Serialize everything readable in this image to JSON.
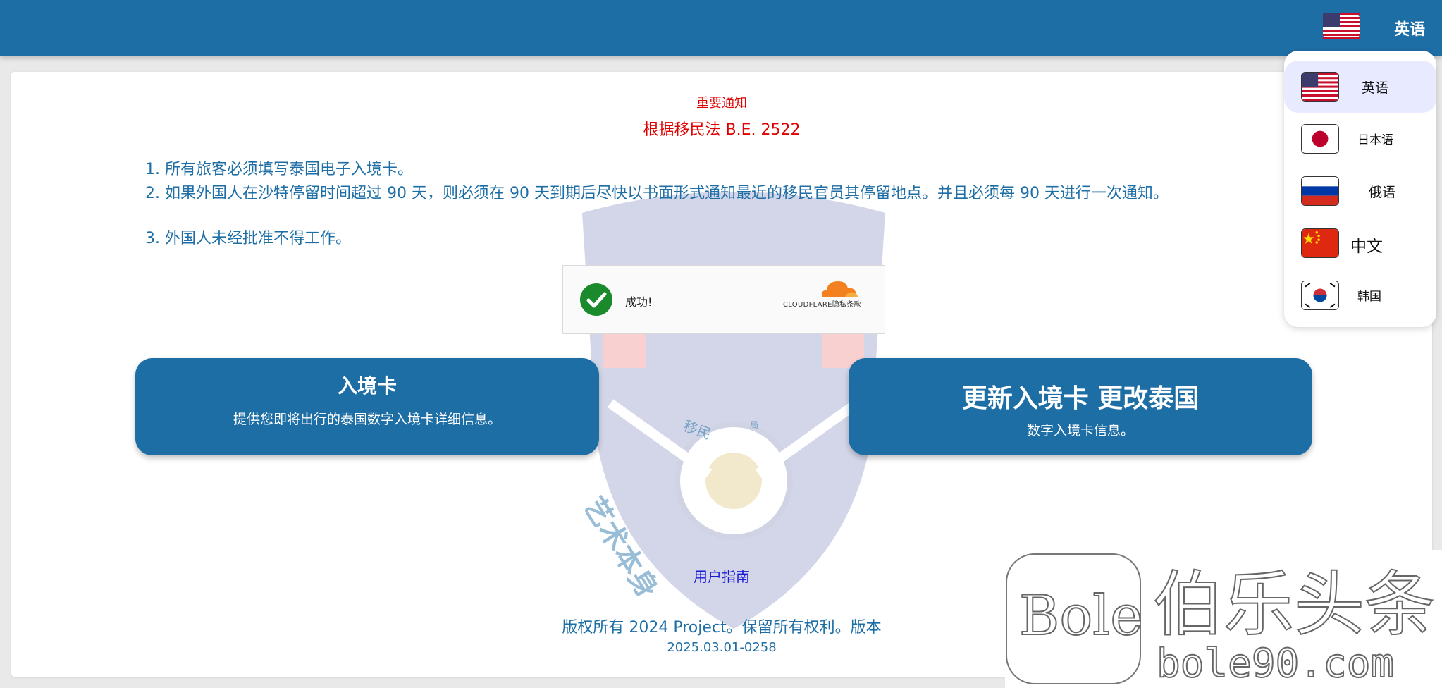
{
  "header": {
    "current_language": "英语",
    "flag_icon": "us-flag-icon"
  },
  "notice": {
    "title": "重要通知",
    "subtitle": "根据移民法 B.E. 2522"
  },
  "rules": [
    "1. 所有旅客必须填写泰国电子入境卡。",
    "2. 如果外国人在沙特停留时间超过 90 天，则必须在 90 天到期后尽快以书面形式通知最近的移民官员其停留地点。并且必须每 90 天进行一次通知。",
    "3. 外国人未经批准不得工作。"
  ],
  "captcha": {
    "status": "成功!",
    "brand": "CLOUDFLARE",
    "privacy": "隐私条款",
    "check_color": "#1a8a2c"
  },
  "actions": {
    "arrival_card": {
      "title": "入境卡",
      "desc": "提供您即将出行的泰国数字入境卡详细信息。"
    },
    "update_card": {
      "title": "更新入境卡 更改泰国",
      "desc": "数字入境卡信息。"
    }
  },
  "watermark_text": {
    "diagonal": "艺术本身",
    "center": "移民",
    "label": "局"
  },
  "footer": {
    "user_guide": "用户指南",
    "copyright": "版权所有 2024 Project。保留所有权利。版本",
    "version": "2025.03.01-0258"
  },
  "language_menu": [
    {
      "label": "英语",
      "flag": "us-flag-icon",
      "active": true
    },
    {
      "label": "日本语",
      "flag": "japan-flag-icon",
      "active": false
    },
    {
      "label": "俄语",
      "flag": "russia-flag-icon",
      "active": false
    },
    {
      "label": "中文",
      "flag": "china-flag-icon",
      "active": false
    },
    {
      "label": "韩国",
      "flag": "korea-flag-icon",
      "active": false
    }
  ],
  "brand_watermark": {
    "name": "伯乐头条",
    "site": "bole90.com",
    "logo": "Bole"
  },
  "colors": {
    "primary": "#1e6ea6",
    "notice_red": "#e00000",
    "link_blue": "#1a1ad8"
  }
}
